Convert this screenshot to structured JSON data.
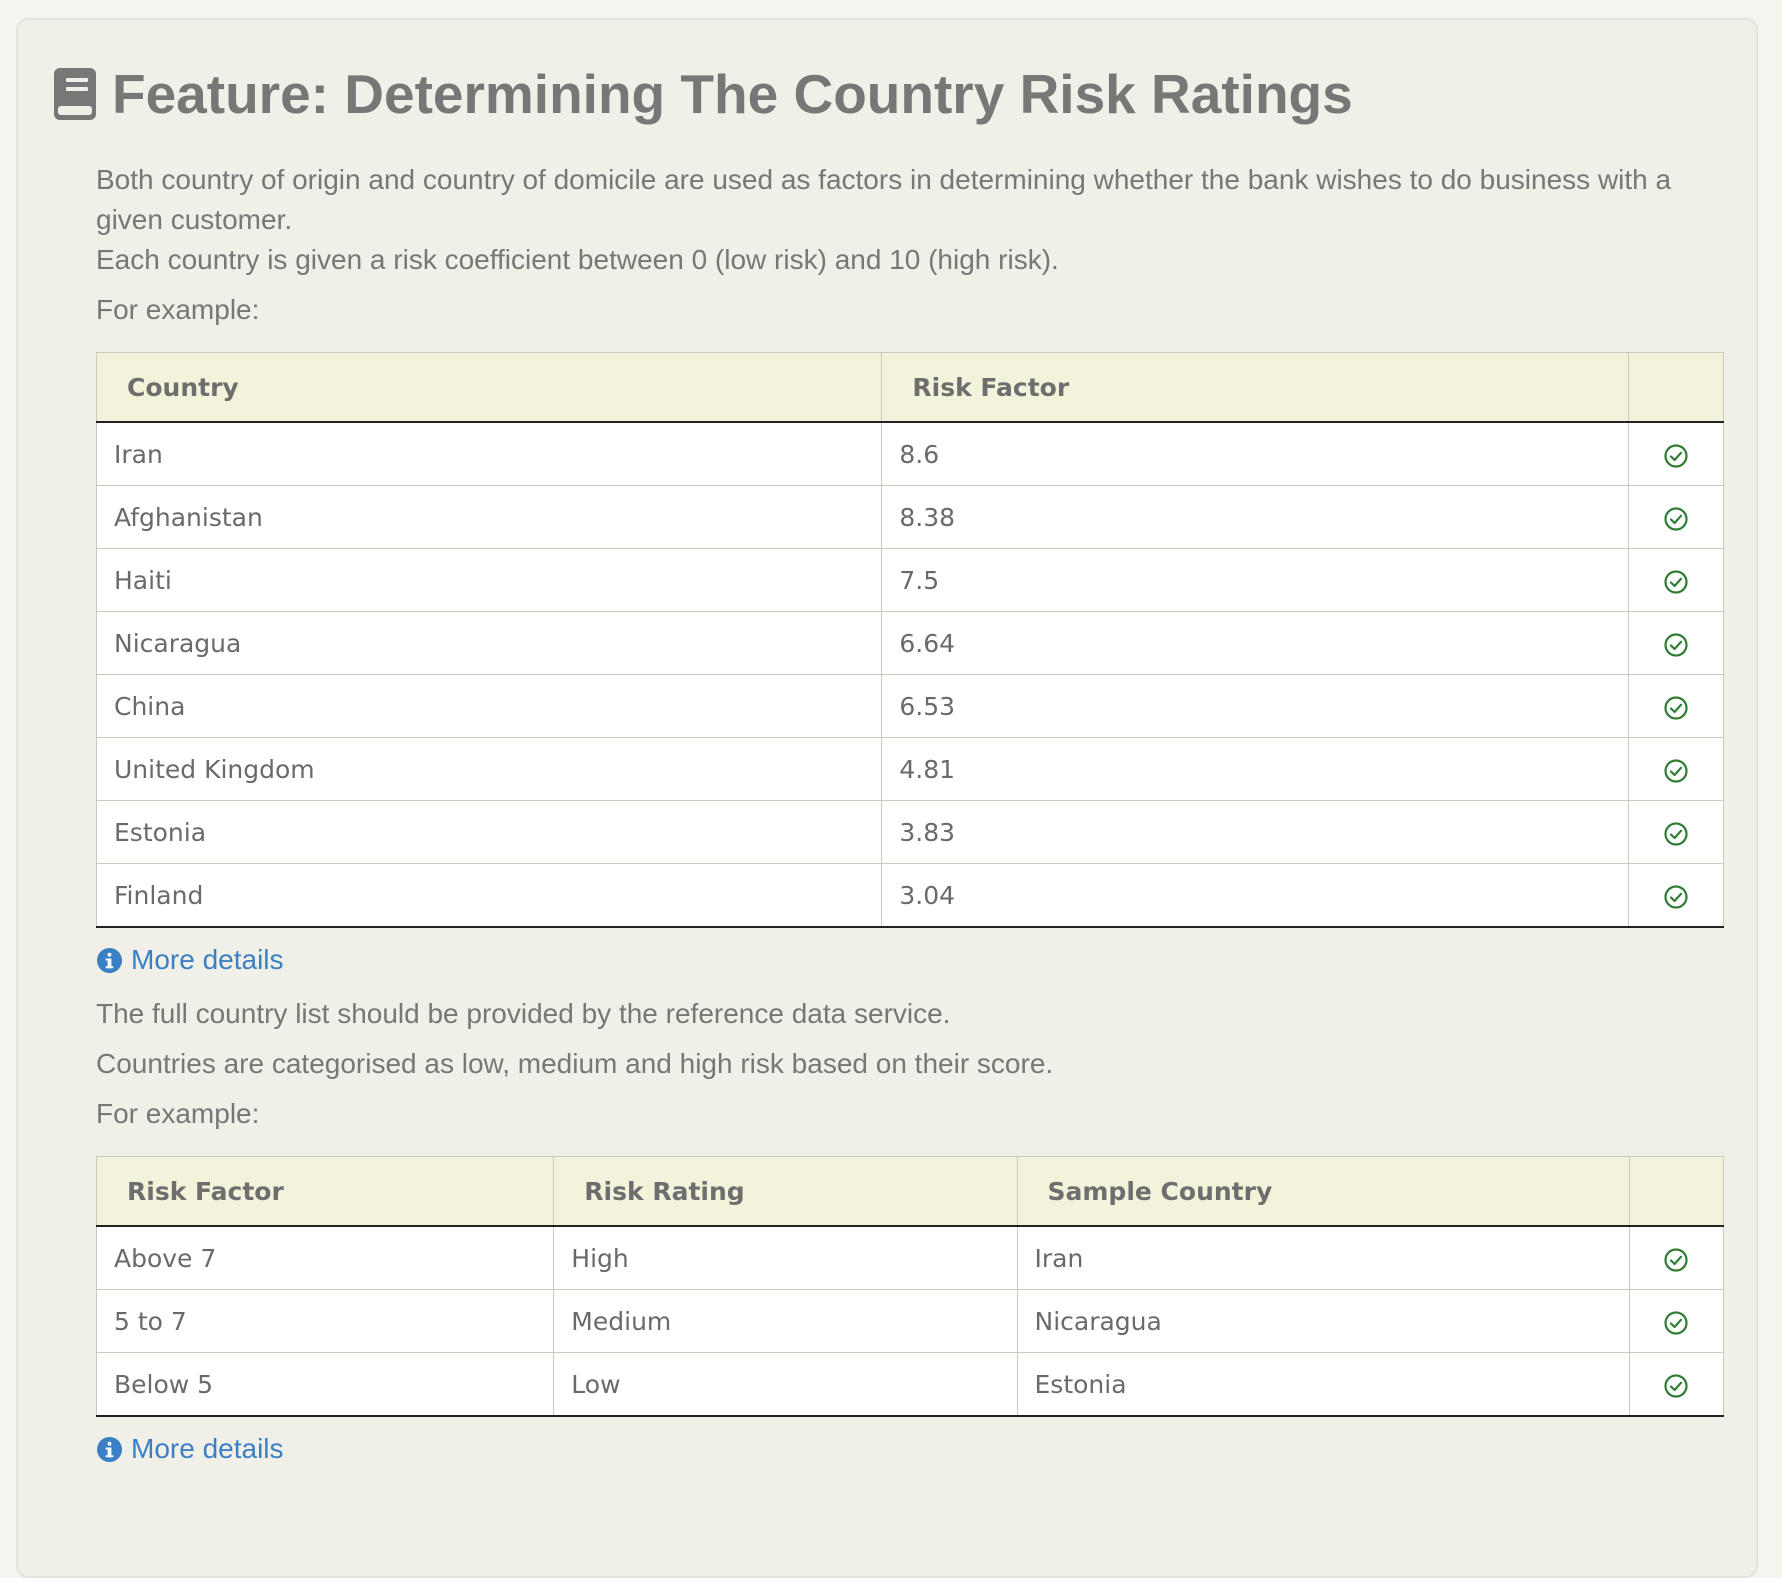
{
  "title": "Feature: Determining The Country Risk Ratings",
  "intro": {
    "p1": "Both country of origin and country of domicile are used as factors in determining whether the bank wishes to do business with a given customer.",
    "p2": "Each country is given a risk coefficient between 0 (low risk) and 10 (high risk).",
    "p3": "For example:"
  },
  "table1": {
    "headers": [
      "Country",
      "Risk Factor",
      ""
    ],
    "rows": [
      {
        "country": "Iran",
        "risk_factor": "8.6",
        "status": "passed"
      },
      {
        "country": "Afghanistan",
        "risk_factor": "8.38",
        "status": "passed"
      },
      {
        "country": "Haiti",
        "risk_factor": "7.5",
        "status": "passed"
      },
      {
        "country": "Nicaragua",
        "risk_factor": "6.64",
        "status": "passed"
      },
      {
        "country": "China",
        "risk_factor": "6.53",
        "status": "passed"
      },
      {
        "country": "United Kingdom",
        "risk_factor": "4.81",
        "status": "passed"
      },
      {
        "country": "Estonia",
        "risk_factor": "3.83",
        "status": "passed"
      },
      {
        "country": "Finland",
        "risk_factor": "3.04",
        "status": "passed"
      }
    ]
  },
  "more_details_1": "More details",
  "middle": {
    "p1": "The full country list should be provided by the reference data service.",
    "p2": "Countries are categorised as low, medium and high risk based on their score.",
    "p3": "For example:"
  },
  "table2": {
    "headers": [
      "Risk Factor",
      "Risk Rating",
      "Sample Country",
      ""
    ],
    "rows": [
      {
        "risk_factor": "Above 7",
        "risk_rating": "High",
        "sample_country": "Iran",
        "status": "passed"
      },
      {
        "risk_factor": "5 to 7",
        "risk_rating": "Medium",
        "sample_country": "Nicaragua",
        "status": "passed"
      },
      {
        "risk_factor": "Below 5",
        "risk_rating": "Low",
        "sample_country": "Estonia",
        "status": "passed"
      }
    ]
  },
  "more_details_2": "More details",
  "icons": {
    "title_icon": "book-icon",
    "row_status_icon": "check-circle-icon",
    "details_icon": "info-circle-icon"
  },
  "colors": {
    "text": "#777777",
    "link": "#3b7fc4",
    "check": "#2e7d32",
    "header_bg": "#f3f3dc"
  }
}
